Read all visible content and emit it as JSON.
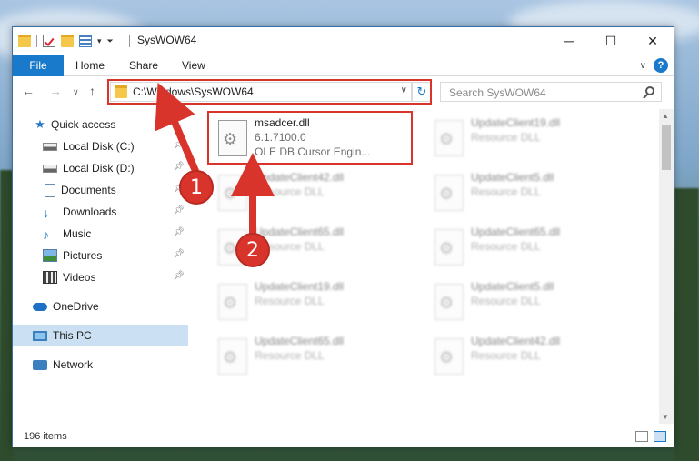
{
  "window": {
    "title": "SysWOW64"
  },
  "ribbon": {
    "tabs": [
      "File",
      "Home",
      "Share",
      "View"
    ]
  },
  "address": {
    "path": "C:\\Windows\\SysWOW64"
  },
  "search": {
    "placeholder": "Search SysWOW64"
  },
  "sidebar": {
    "items": [
      {
        "label": "Quick access",
        "icon": "star-icon"
      },
      {
        "label": "Local Disk (C:)",
        "icon": "drive-icon"
      },
      {
        "label": "Local Disk (D:)",
        "icon": "drive-icon"
      },
      {
        "label": "Documents",
        "icon": "documents-icon"
      },
      {
        "label": "Downloads",
        "icon": "downloads-icon"
      },
      {
        "label": "Music",
        "icon": "music-icon"
      },
      {
        "label": "Pictures",
        "icon": "pictures-icon"
      },
      {
        "label": "Videos",
        "icon": "videos-icon"
      },
      {
        "label": "OneDrive",
        "icon": "onedrive-icon"
      },
      {
        "label": "This PC",
        "icon": "this-pc-icon",
        "selected": true
      },
      {
        "label": "Network",
        "icon": "network-icon"
      }
    ]
  },
  "files": {
    "highlighted": {
      "name": "msadcer.dll",
      "version": "6.1.7100.0",
      "description": "OLE DB Cursor Engin..."
    },
    "others": [
      {
        "name": "UpdateClient19.dll",
        "type": "Resource DLL"
      },
      {
        "name": "UpdateClient42.dll",
        "type": "Resource DLL"
      },
      {
        "name": "UpdateClient5.dll",
        "type": "Resource DLL"
      },
      {
        "name": "UpdateClient65.dll",
        "type": "Resource DLL"
      },
      {
        "name": "UpdateClient65.dll",
        "type": "Resource DLL"
      },
      {
        "name": "UpdateClient19.dll",
        "type": "Resource DLL"
      },
      {
        "name": "UpdateClient5.dll",
        "type": "Resource DLL"
      },
      {
        "name": "UpdateClient65.dll",
        "type": "Resource DLL"
      },
      {
        "name": "UpdateClient42.dll",
        "type": "Resource DLL"
      }
    ]
  },
  "status": {
    "count": "196 items"
  },
  "annotations": {
    "step1": "1",
    "step2": "2"
  },
  "colors": {
    "accent": "#1979ca",
    "highlight": "#d9342b",
    "selection": "#cce0f3"
  }
}
